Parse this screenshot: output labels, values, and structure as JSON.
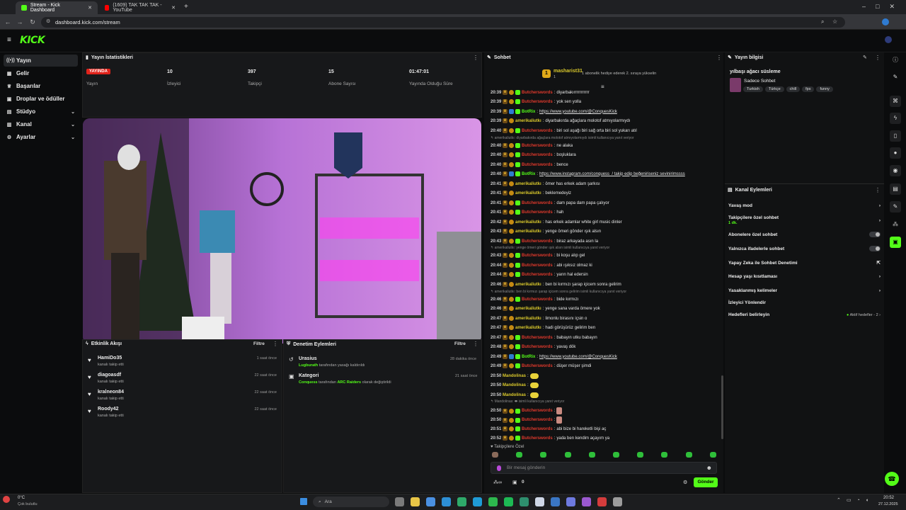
{
  "browser": {
    "tabs": [
      {
        "title": "Stream - Kick Dashboard",
        "color": "#53fc18"
      },
      {
        "title": "(1609) TAK TAK TAK - YouTube",
        "color": "#ff0000"
      }
    ],
    "url": "dashboard.kick.com/stream"
  },
  "app": {
    "logo": "KICK",
    "accent": "#53fc18"
  },
  "sidebar": {
    "items": [
      {
        "label": "Yayın",
        "icon": "broadcast-icon"
      },
      {
        "label": "Gelir",
        "icon": "revenue-icon"
      },
      {
        "label": "Başarılar",
        "icon": "trophy-icon"
      },
      {
        "label": "Droplar ve ödüller",
        "icon": "gift-icon"
      },
      {
        "label": "Stüdyo",
        "icon": "studio-icon"
      },
      {
        "label": "Kanal",
        "icon": "channel-icon"
      },
      {
        "label": "Ayarlar",
        "icon": "settings-icon"
      }
    ]
  },
  "stats": {
    "title": "Yayın İstatistikleri",
    "live_badge": "YAYINDA",
    "live_label": "Yayın",
    "viewers_value": "10",
    "viewers_label": "İzleyici",
    "followers_value": "397",
    "followers_label": "Takipçi",
    "subs_value": "15",
    "subs_label": "Abone Sayısı",
    "duration_value": "01:47:01",
    "duration_label": "Yayında Olduğu Süre"
  },
  "activity": {
    "title": "Etkinlik Akışı",
    "filter": "Filtre",
    "items": [
      {
        "name": "HamiDo35",
        "sub": "kanalı takip etti",
        "time": "1 saat önce"
      },
      {
        "name": "diagoasdf",
        "sub": "kanalı takip etti",
        "time": "22 saat önce"
      },
      {
        "name": "kralneon84",
        "sub": "kanalı takip etti",
        "time": "22 saat önce"
      },
      {
        "name": "Roody42",
        "sub": "kanalı takip etti",
        "time": "22 saat önce"
      }
    ]
  },
  "moderation": {
    "title": "Denetim Eylemleri",
    "filter": "Filtre",
    "items": [
      {
        "title": "Urasius",
        "actor": "Lugburath",
        "text": "tarafından yasağı kaldırıldı",
        "time": "28 dakika önce"
      },
      {
        "title": "Kategori",
        "actor": "Conquess",
        "text": "tarafından",
        "target": "ARC Raiders",
        "text2": "olarak değiştirildi",
        "time": "21 saat önce"
      }
    ]
  },
  "chat": {
    "title": "Sohbet",
    "gifter_name": "masharist31",
    "gifter_sub": "1",
    "gifter_msg": "1 abonelik hediye ederek 2. sıraya yükselin",
    "followers_only": "Takipçilere Özel",
    "input_placeholder": "Bir mesaj gönderin",
    "send": "Gönder",
    "bottom_count1": "0",
    "bottom_count2": "0"
  },
  "streaminfo": {
    "title": "Yayın bilgisi",
    "stream_title": "yılbaşı ağacı süsleme",
    "category": "Sadece Sohbet",
    "tags": [
      "Turkish",
      "Türkçe",
      "chill",
      "fps",
      "funny"
    ]
  },
  "channel_actions": {
    "title": "Kanal Eylemleri",
    "items": [
      {
        "label": "Yavaş mod",
        "control": "chevron"
      },
      {
        "label": "Takipçilere özel sohbet",
        "sub": "1 dk.",
        "control": "chevron"
      },
      {
        "label": "Abonelere özel sohbet",
        "control": "toggle"
      },
      {
        "label": "Yalnızca ifadelerle sohbet",
        "control": "toggle"
      },
      {
        "label": "Yapay Zeka ile Sohbet Denetimi",
        "control": "external"
      },
      {
        "label": "Hesap yaşı kısıtlaması",
        "control": "chevron"
      },
      {
        "label": "Yasaklanmış kelimeler",
        "control": "chevron"
      },
      {
        "label": "İzleyici Yönlendir",
        "control": "none"
      },
      {
        "label": "Hedefleri belirleyin",
        "sub_right": "Aktif hedefler - 2",
        "control": "chevron"
      }
    ]
  },
  "taskbar": {
    "weather_temp": "0°C",
    "weather_desc": "Çok bulutlu",
    "search": "Ara",
    "time": "20:52",
    "date": "27.12.2025"
  }
}
